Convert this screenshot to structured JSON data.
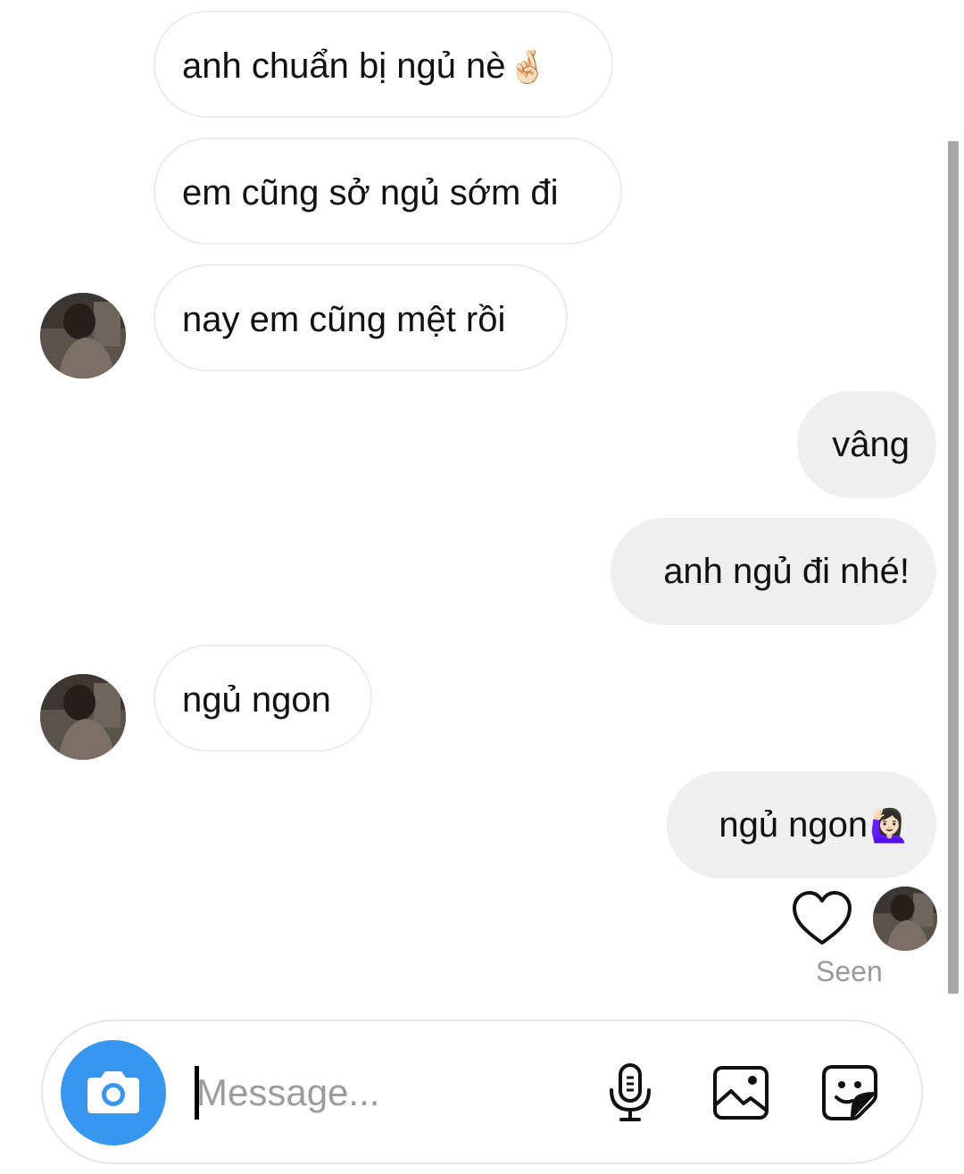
{
  "messages": [
    {
      "text": "anh chuẩn bị ngủ nè",
      "emoji": "🤞🏻",
      "direction": "incoming"
    },
    {
      "text": "em cũng sở ngủ sớm đi",
      "direction": "incoming"
    },
    {
      "text": "nay em cũng mệt rồi",
      "direction": "incoming",
      "avatar": true
    },
    {
      "text": "vâng",
      "direction": "outgoing"
    },
    {
      "text": "anh ngủ đi nhé!",
      "direction": "outgoing"
    },
    {
      "text": "ngủ ngon",
      "direction": "incoming",
      "avatar": true
    },
    {
      "text": "ngủ ngon",
      "emoji": "🙋🏻‍♀️",
      "direction": "outgoing"
    }
  ],
  "status": {
    "seen_label": "Seen",
    "reaction_icon": "heart-outline-icon"
  },
  "composer": {
    "placeholder": "Message...",
    "value": "",
    "icons": [
      "camera-icon",
      "microphone-icon",
      "gallery-icon",
      "sticker-icon"
    ]
  },
  "colors": {
    "camera_button": "#3797f0",
    "outgoing_bubble": "#efefef",
    "incoming_border": "#ececec",
    "seen_text": "#9a9a9a"
  }
}
